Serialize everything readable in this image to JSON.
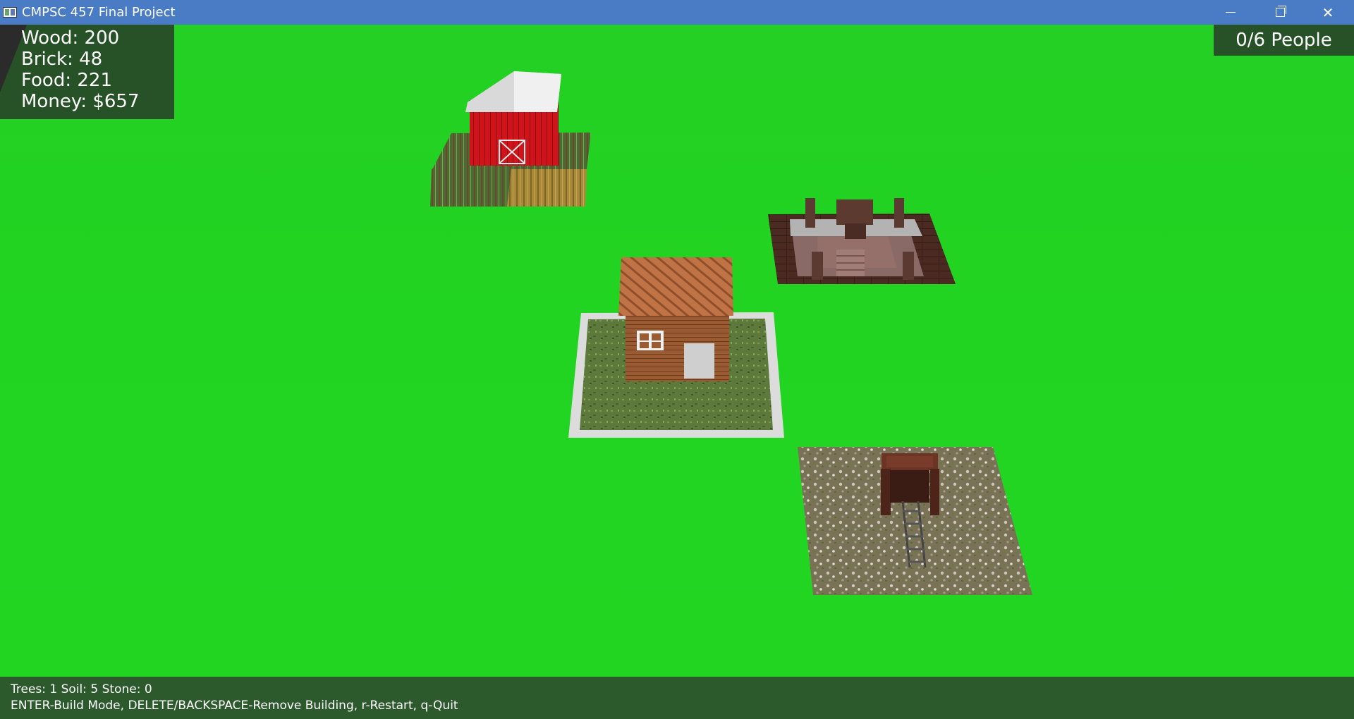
{
  "window": {
    "title": "CMPSC 457 Final Project",
    "icon": "app-window-icon",
    "controls": {
      "minimize": "minimize-icon",
      "maximize": "restore-icon",
      "close": "close-icon",
      "close_glyph": "✕"
    }
  },
  "hud": {
    "resources": [
      "Wood: 200",
      "Brick: 48",
      "Food: 221",
      "Money: $657"
    ],
    "people": "0/6 People"
  },
  "scene": {
    "buildings": [
      "farm",
      "quarry",
      "house",
      "mine"
    ],
    "selected": "house"
  },
  "status": {
    "counts": "Trees: 1 Soil: 5 Stone: 0",
    "help": "ENTER-Build Mode, DELETE/BACKSPACE-Remove Building, r-Restart, q-Quit"
  },
  "colors": {
    "titlebar": "#4a7cc6",
    "grass": "#22d522",
    "hud_panel": "#284628",
    "statusbar": "#2d5a2d",
    "barn_red": "#c4121a",
    "selection": "#dcdcdc"
  }
}
